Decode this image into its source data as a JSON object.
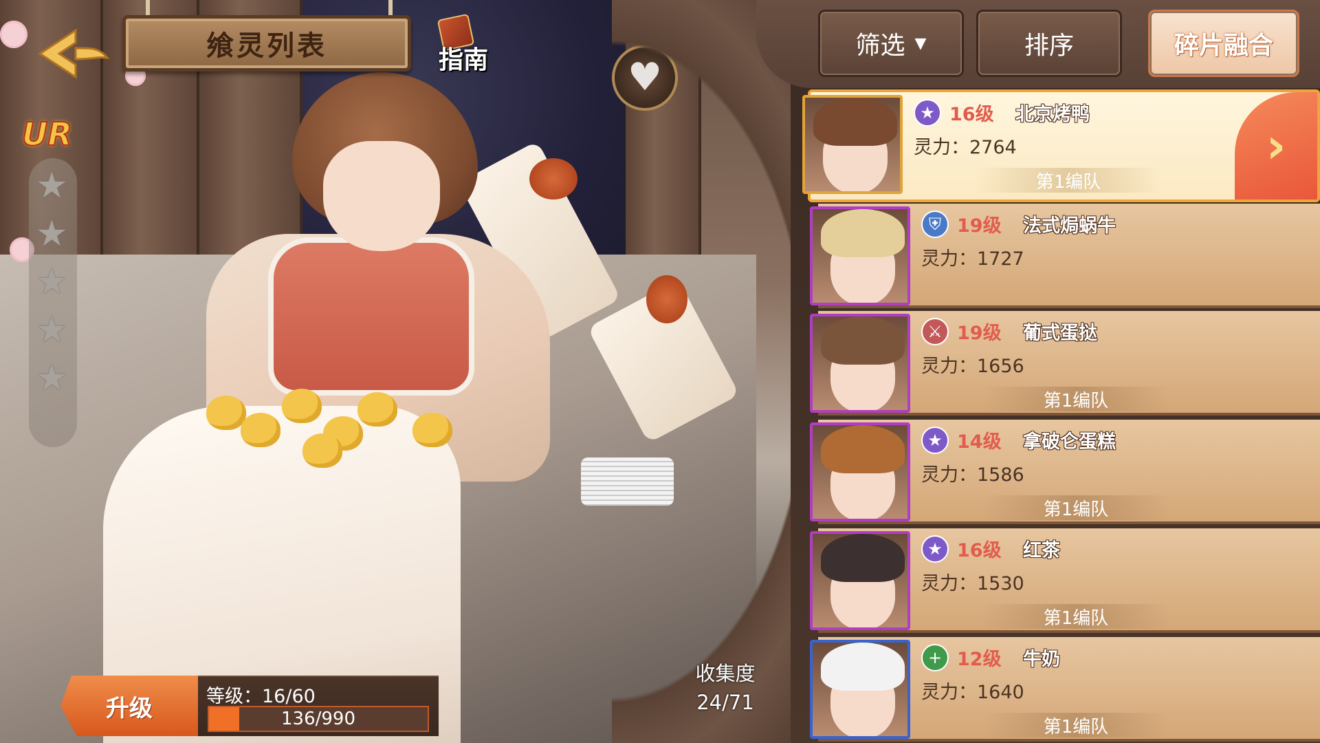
{
  "header": {
    "title": "飨灵列表",
    "guide_label": "指南"
  },
  "character": {
    "rarity": "UR",
    "stars_filled": 0,
    "stars_total": 5
  },
  "level_panel": {
    "upgrade_label": "升级",
    "level_text": "等级：16/60",
    "exp_text": "136/990",
    "exp_fraction": 0.137
  },
  "collection": {
    "label": "收集度",
    "value": "24/71"
  },
  "toolbar": {
    "filter_label": "筛选",
    "sort_label": "排序",
    "fusion_label": "碎片融合"
  },
  "list": [
    {
      "level": "16级",
      "name": "北京烤鸭",
      "power": "灵力：2764",
      "team": "第1编队",
      "class_icon": "star-icon",
      "frame": "gold"
    },
    {
      "level": "19级",
      "name": "法式焗蜗牛",
      "power": "灵力：1727",
      "team": "",
      "class_icon": "shield-icon",
      "frame": "purple"
    },
    {
      "level": "19级",
      "name": "葡式蛋挞",
      "power": "灵力：1656",
      "team": "第1编队",
      "class_icon": "sword-icon",
      "frame": "purple"
    },
    {
      "level": "14级",
      "name": "拿破仑蛋糕",
      "power": "灵力：1586",
      "team": "第1编队",
      "class_icon": "star-icon",
      "frame": "purple"
    },
    {
      "level": "16级",
      "name": "红茶",
      "power": "灵力：1530",
      "team": "第1编队",
      "class_icon": "star-icon",
      "frame": "purple"
    },
    {
      "level": "12级",
      "name": "牛奶",
      "power": "灵力：1640",
      "team": "第1编队",
      "class_icon": "plus-icon",
      "frame": "blue"
    }
  ],
  "colors": {
    "accent_orange": "#e9573a",
    "level_red": "#e15c4c",
    "row_tan": "#e7c6a0"
  }
}
